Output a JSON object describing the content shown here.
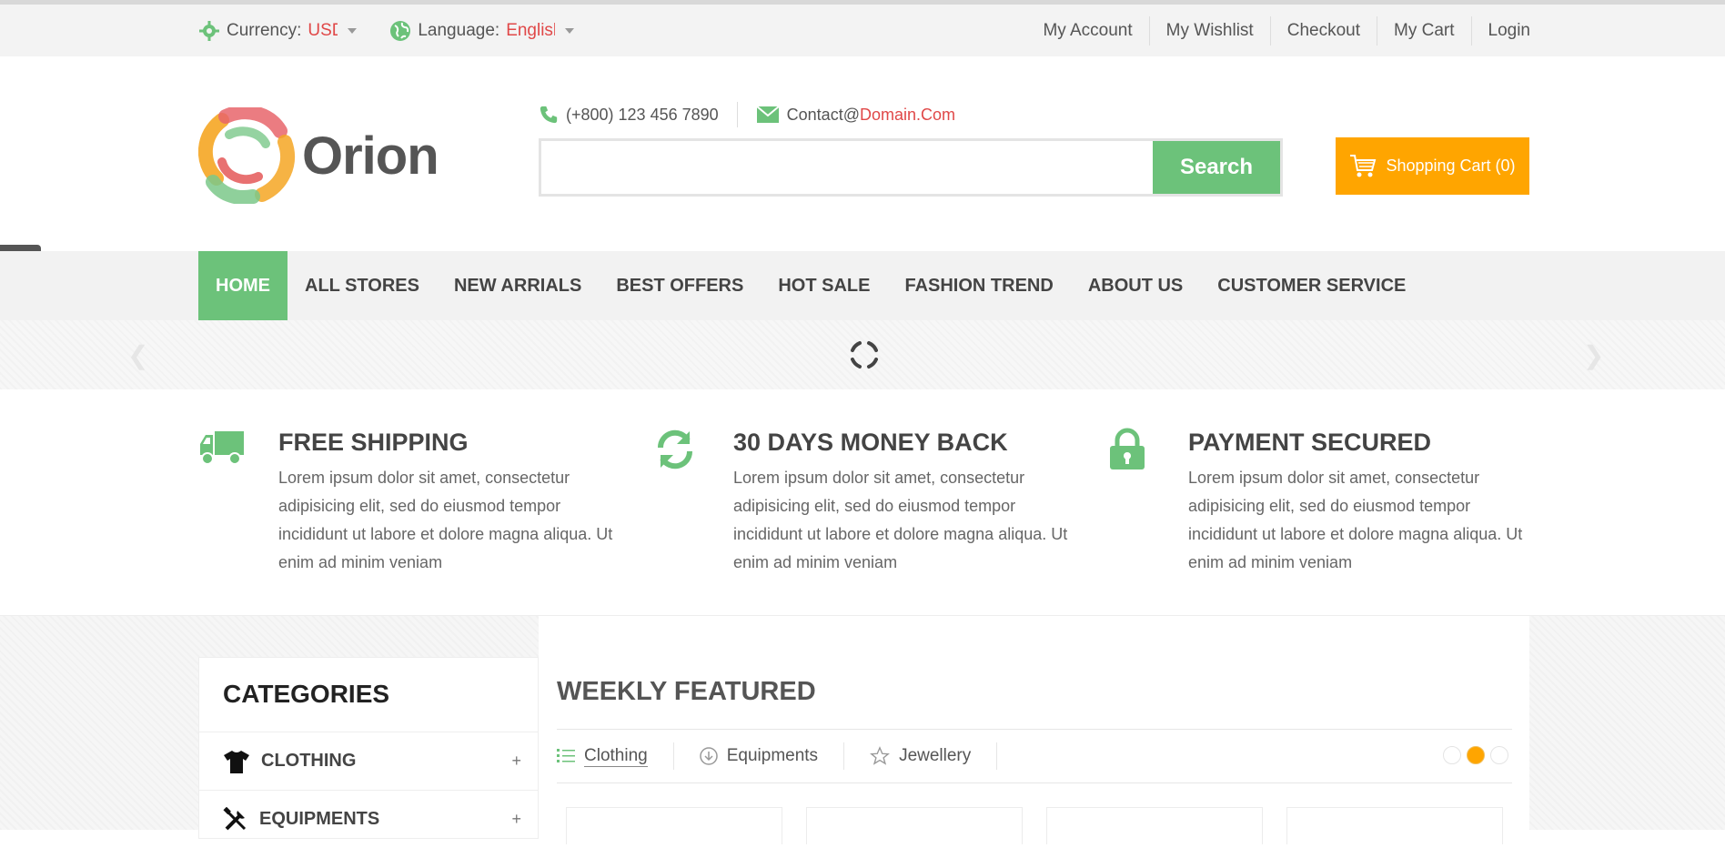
{
  "topbar": {
    "currency_label": "Currency:",
    "currency_value": "USD",
    "language_label": "Language:",
    "language_value": "English",
    "links": [
      "My Account",
      "My Wishlist",
      "Checkout",
      "My Cart",
      "Login"
    ]
  },
  "header": {
    "logo_text": "Orion",
    "phone": "(+800) 123 456 7890",
    "email_prefix": "Contact@",
    "email_domain": "Domain.Com",
    "search_placeholder": "",
    "search_button": "Search",
    "cart_label": "Shopping Cart (0)"
  },
  "nav": {
    "items": [
      "HOME",
      "ALL STORES",
      "NEW ARRIALS",
      "BEST OFFERS",
      "HOT SALE",
      "FASHION TREND",
      "ABOUT US",
      "CUSTOMER SERVICE"
    ],
    "active": "HOME"
  },
  "features": [
    {
      "title": "FREE SHIPPING",
      "text": "Lorem ipsum dolor sit amet, consectetur adipisicing elit, sed do eiusmod tempor incididunt ut labore et dolore magna aliqua. Ut enim ad minim veniam",
      "icon": "truck-icon"
    },
    {
      "title": "30 DAYS MONEY BACK",
      "text": "Lorem ipsum dolor sit amet, consectetur adipisicing elit, sed do eiusmod tempor incididunt ut labore et dolore magna aliqua. Ut enim ad minim veniam",
      "icon": "refresh-icon"
    },
    {
      "title": "PAYMENT SECURED",
      "text": "Lorem ipsum dolor sit amet, consectetur adipisicing elit, sed do eiusmod tempor incididunt ut labore et dolore magna aliqua. Ut enim ad minim veniam",
      "icon": "lock-icon"
    }
  ],
  "categories": {
    "title": "CATEGORIES",
    "items": [
      "CLOTHING",
      "EQUIPMENTS"
    ]
  },
  "featured": {
    "title": "WEEKLY FEATURED",
    "tabs": [
      "Clothing",
      "Equipments",
      "Jewellery"
    ]
  },
  "colors": {
    "accent_green": "#6cc27a",
    "cart_orange": "#ffa500",
    "link_red": "#e04848"
  }
}
